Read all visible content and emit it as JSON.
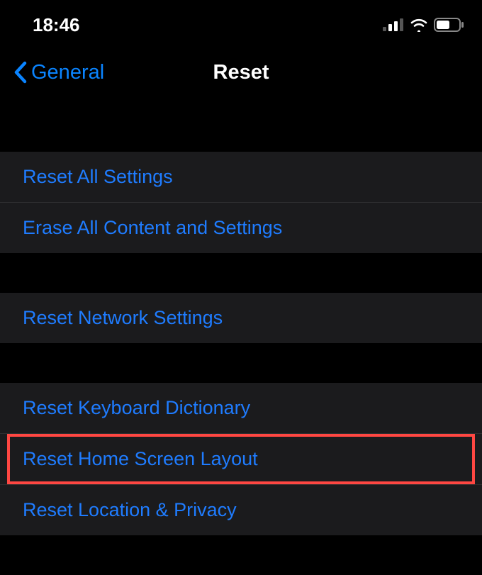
{
  "status_bar": {
    "time": "18:46"
  },
  "nav": {
    "back_label": "General",
    "title": "Reset"
  },
  "groups": [
    {
      "rows": [
        {
          "label": "Reset All Settings"
        },
        {
          "label": "Erase All Content and Settings"
        }
      ]
    },
    {
      "rows": [
        {
          "label": "Reset Network Settings"
        }
      ]
    },
    {
      "rows": [
        {
          "label": "Reset Keyboard Dictionary"
        },
        {
          "label": "Reset Home Screen Layout"
        },
        {
          "label": "Reset Location & Privacy"
        }
      ]
    }
  ]
}
